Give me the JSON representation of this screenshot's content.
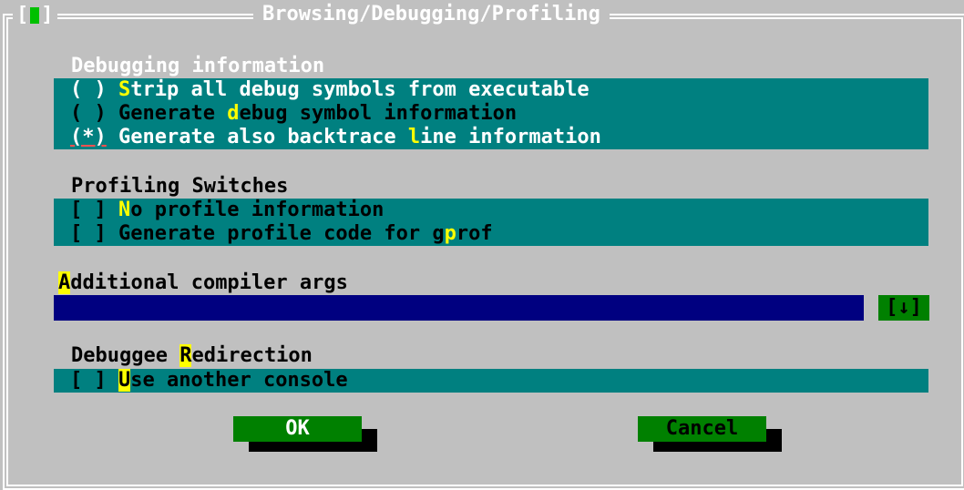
{
  "window": {
    "title": "Browsing/Debugging/Profiling",
    "close_label": "[ ]"
  },
  "debugging": {
    "heading": "Debugging information",
    "options": [
      {
        "mark": "( )",
        "pre": "",
        "hot": "S",
        "post": "trip all debug symbols from executable"
      },
      {
        "mark": "( )",
        "pre": "Generate ",
        "hot": "d",
        "post": "ebug symbol information"
      },
      {
        "mark": "(*)",
        "pre": "Generate also backtrace ",
        "hot": "l",
        "post": "ine information"
      }
    ]
  },
  "profiling": {
    "heading": "Profiling Switches",
    "options": [
      {
        "mark": "[ ]",
        "pre": "",
        "hot": "N",
        "post": "o profile information"
      },
      {
        "mark": "[ ]",
        "pre": "Generate profile code for g",
        "hot": "p",
        "post": "rof"
      }
    ]
  },
  "compiler_args": {
    "hot": "A",
    "label": "dditional compiler args",
    "value": "",
    "dropdown_label": "[↓]"
  },
  "redirection": {
    "pre": "Debuggee ",
    "hot": "R",
    "post": "edirection",
    "options": [
      {
        "mark": "[ ]",
        "pre": "",
        "hot": "U",
        "post": "se another console"
      }
    ]
  },
  "buttons": {
    "ok": "OK",
    "cancel": "Cancel"
  },
  "colors": {
    "background": "#c0c0c0",
    "group": "#008080",
    "input": "#000080",
    "button": "#008000",
    "hotkey": "#ffff00"
  }
}
